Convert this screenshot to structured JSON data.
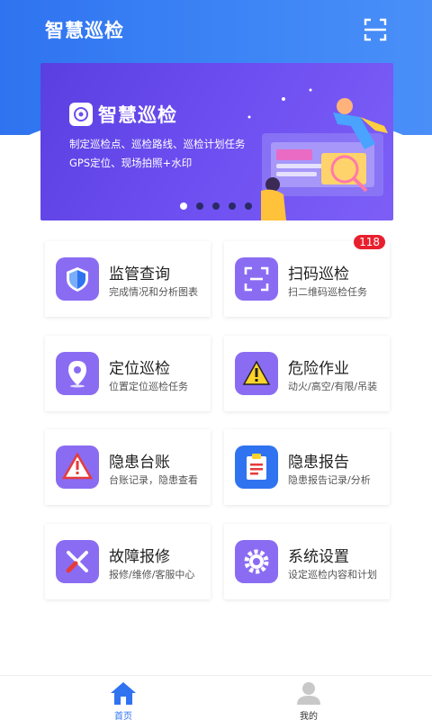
{
  "header": {
    "title": "智慧巡检",
    "scan_icon": "scan-icon",
    "accent": "#3b82f6"
  },
  "banner": {
    "logo_text": "智慧巡检",
    "line1": "制定巡检点、巡检路线、巡检计划任务",
    "line2": "GPS定位、现场拍照+水印",
    "slide_count": 5,
    "active_slide": 1
  },
  "cards": [
    {
      "label": "监管查询",
      "sub": "完成情况和分析图表",
      "icon": "shield-icon"
    },
    {
      "label": "扫码巡检",
      "sub": "扫二维码巡检任务",
      "icon": "qr-scan-icon",
      "badge": "118"
    },
    {
      "label": "定位巡检",
      "sub": "位置定位巡检任务",
      "icon": "location-pin-icon"
    },
    {
      "label": "危险作业",
      "sub": "动火/高空/有限/吊装",
      "icon": "warning-sign-icon"
    },
    {
      "label": "隐患台账",
      "sub": "台账记录，隐患查看",
      "icon": "hazard-triangle-icon"
    },
    {
      "label": "隐患报告",
      "sub": "隐患报告记录/分析",
      "icon": "clipboard-report-icon"
    },
    {
      "label": "故障报修",
      "sub": "报修/维修/客服中心",
      "icon": "wrench-screwdriver-icon"
    },
    {
      "label": "系统设置",
      "sub": "设定巡检内容和计划",
      "icon": "gear-icon"
    }
  ],
  "tabbar": {
    "home_label": "首页",
    "mine_label": "我的",
    "active_color": "#2f73f0",
    "inactive_color": "#333333"
  }
}
